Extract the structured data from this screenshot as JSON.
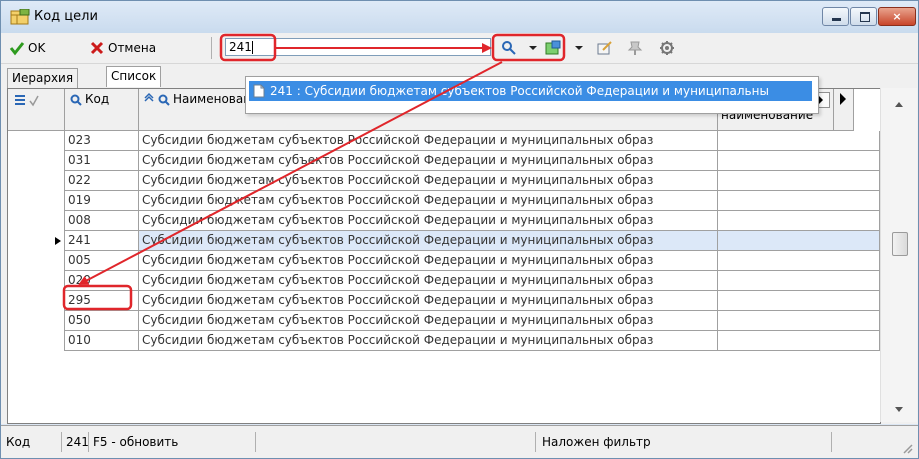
{
  "window": {
    "title": "Код цели",
    "min_label": "",
    "max_label": "",
    "close_label": "×"
  },
  "toolbar": {
    "ok_label": "OK",
    "cancel_label": "Отмена",
    "search_value": "241"
  },
  "dropdown": {
    "item": "241 : Субсидии бюджетам субъектов Российской Федерации и муниципальны"
  },
  "tabs": [
    {
      "label": "Иерархия"
    },
    {
      "label": "Список"
    }
  ],
  "grid": {
    "col_code": "Код",
    "col_name": "Наименование",
    "col_short": "Краткое наименование",
    "rows": [
      {
        "code": "023",
        "name": "Субсидии бюджетам субъектов Российской Федерации и муниципальных образ"
      },
      {
        "code": "031",
        "name": "Субсидии бюджетам субъектов Российской Федерации и муниципальных образ"
      },
      {
        "code": "022",
        "name": "Субсидии бюджетам субъектов Российской Федерации и муниципальных образ"
      },
      {
        "code": "019",
        "name": "Субсидии бюджетам субъектов Российской Федерации и муниципальных образ"
      },
      {
        "code": "008",
        "name": "Субсидии бюджетам субъектов Российской Федерации и муниципальных образ"
      },
      {
        "code": "241",
        "name": "Субсидии бюджетам субъектов Российской Федерации и муниципальных образ",
        "selected": true
      },
      {
        "code": "005",
        "name": "Субсидии бюджетам субъектов Российской Федерации и муниципальных образ"
      },
      {
        "code": "020",
        "name": "Субсидии бюджетам субъектов Российской Федерации и муниципальных образ"
      },
      {
        "code": "295",
        "name": "Субсидии бюджетам субъектов Российской Федерации и муниципальных образ"
      },
      {
        "code": "050",
        "name": "Субсидии бюджетам субъектов Российской Федерации и муниципальных образ"
      },
      {
        "code": "010",
        "name": "Субсидии бюджетам субъектов Российской Федерации и муниципальных образ"
      }
    ]
  },
  "status": {
    "field": "Код",
    "value": "241",
    "hint": "F5 - обновить",
    "filter": "Наложен фильтр"
  },
  "colors": {
    "annotation": "#e0262b",
    "selection": "#3b8de4",
    "selected_row": "#dce8f8"
  }
}
